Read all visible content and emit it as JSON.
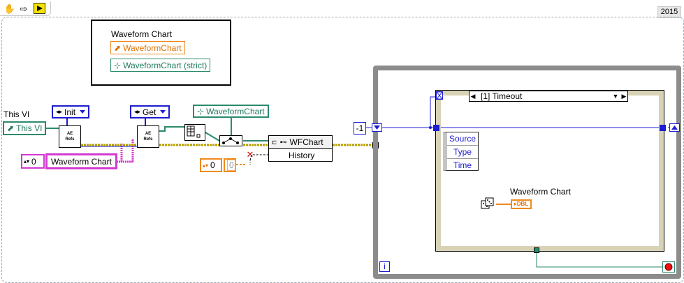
{
  "toolbar": {
    "icons": [
      "hand-icon",
      "arrow-right-icon",
      "run-icon"
    ],
    "version": "2015"
  },
  "frontpanel_refs": {
    "title": "Waveform Chart",
    "ref_label": "WaveformChart",
    "strict_label": "WaveformChart (strict)"
  },
  "left": {
    "this_vi_caption": "This VI",
    "this_vi_ref": "This VI",
    "init_label": "Init",
    "get_label": "Get",
    "ae_text": [
      "AE",
      "Refs"
    ],
    "numeric_const": "0",
    "waveform_string": "Waveform Chart",
    "waveform_ref_strict": "WaveformChart",
    "wfchart_node": "WFChart",
    "history_property": "History",
    "orange_index": "0",
    "orange_value": "0"
  },
  "loop": {
    "shift_const": "-1",
    "case_selector": "[1] Timeout",
    "unbundle_items": [
      "Source",
      "Type",
      "Time"
    ],
    "chart_label": "Waveform Chart",
    "dbl_terminal": "DBL",
    "iteration_label": "i"
  },
  "colors": {
    "wire_blue": "#1c1cd0",
    "wire_pink": "#d23ad2",
    "wire_yellow": "#b8a000",
    "wire_green": "#2a8a6e",
    "ref_orange": "#f08a1e",
    "stop_red": "#e81010"
  }
}
